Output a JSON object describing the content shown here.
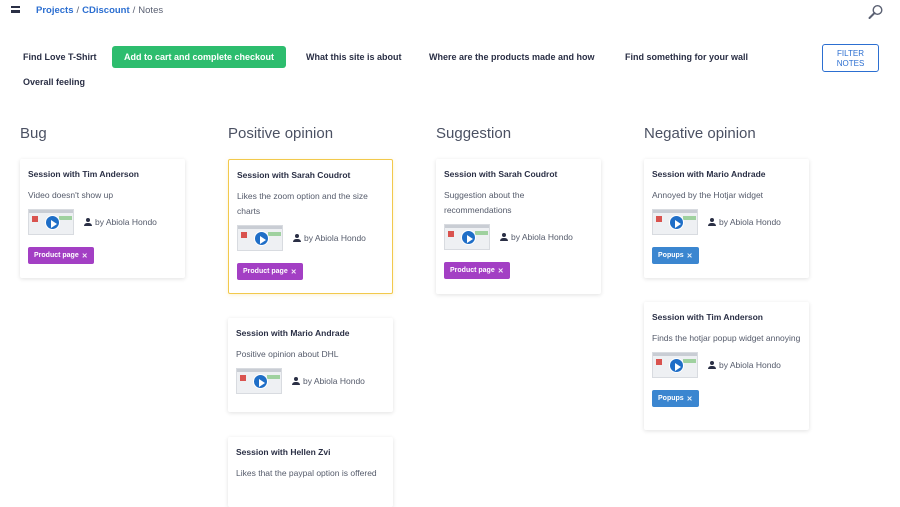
{
  "breadcrumb": {
    "projects": "Projects",
    "project": "CDiscount",
    "page": "Notes"
  },
  "icons": {
    "menu": "hamburger-menu-icon",
    "search": "magnifier-search-icon",
    "user": "user-icon",
    "play": "play-icon",
    "remove": "close-x-icon"
  },
  "colors": {
    "accent_green": "#2dbd6e",
    "link_blue": "#2c6fd1",
    "tag_purple": "#a33fc4",
    "tag_blue": "#3b86d0",
    "highlight_border": "#f2c94c"
  },
  "tabs": [
    "Find Love T-Shirt",
    "Add to cart and complete checkout",
    "What this site is about",
    "Where are the products made and how",
    "Find something for your wall",
    "Overall feeling"
  ],
  "active_tab": "Add to cart and complete checkout",
  "filter_button": {
    "line1": "FILTER",
    "line2": "NOTES"
  },
  "columns": [
    {
      "title": "Bug",
      "cards": [
        {
          "title": "Session with Tim Anderson",
          "note": "Video doesn't show up",
          "author": "by Abiola Hondo",
          "tag": "Product page",
          "tag_close": "✕"
        }
      ]
    },
    {
      "title": "Positive opinion",
      "cards": [
        {
          "title": "Session with Sarah Coudrot",
          "note": "Likes the zoom option and the size charts",
          "author": "by Abiola Hondo",
          "tag": "Product page",
          "tag_close": "✕"
        },
        {
          "title": "Session with Mario Andrade",
          "note": "Positive opinion about DHL",
          "author": "by Abiola Hondo"
        },
        {
          "title": "Session with Hellen Zvi",
          "note": "Likes that the paypal option is offered"
        }
      ]
    },
    {
      "title": "Suggestion",
      "cards": [
        {
          "title": "Session with Sarah Coudrot",
          "note": "Suggestion about the recommendations",
          "author": "by Abiola Hondo",
          "tag": "Product page",
          "tag_close": "✕"
        }
      ]
    },
    {
      "title": "Negative opinion",
      "cards": [
        {
          "title": "Session with Mario Andrade",
          "note": "Annoyed by the Hotjar widget",
          "author": "by Abiola Hondo",
          "tag": "Popups",
          "tag_close": "✕"
        },
        {
          "title": "Session with Tim Anderson",
          "note": "Finds the hotjar popup widget annoying",
          "author": "by Abiola Hondo",
          "tag": "Popups",
          "tag_close": "✕"
        }
      ]
    }
  ]
}
